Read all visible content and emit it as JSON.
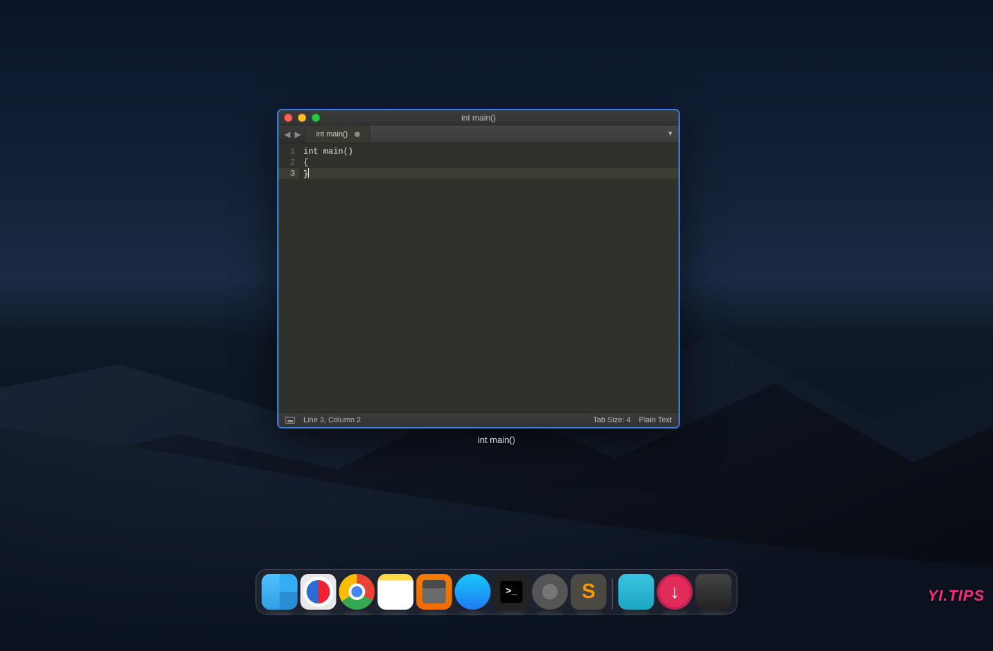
{
  "window": {
    "title": "int main()",
    "tab": {
      "label": "int main()",
      "dirty": true
    },
    "code": {
      "lines": [
        {
          "num": "1",
          "text": "int main()"
        },
        {
          "num": "2",
          "text": "{"
        },
        {
          "num": "3",
          "text": "}",
          "active": true
        }
      ]
    },
    "status": {
      "position": "Line 3, Column 2",
      "tab_size": "Tab Size: 4",
      "syntax": "Plain Text"
    },
    "tabmenu_glyph": "▼",
    "nav_prev": "◀",
    "nav_next": "▶"
  },
  "caption": "int main()",
  "dock": [
    {
      "name": "finder",
      "class": "di-finder"
    },
    {
      "name": "safari",
      "class": "di-safari"
    },
    {
      "name": "chrome",
      "class": "di-chrome"
    },
    {
      "name": "notes",
      "class": "di-notes"
    },
    {
      "name": "calculator",
      "class": "di-calc"
    },
    {
      "name": "app-store",
      "class": "di-appstore"
    },
    {
      "name": "terminal",
      "class": "di-terminal"
    },
    {
      "name": "system-preferences",
      "class": "di-prefs"
    },
    {
      "name": "sublime-text",
      "class": "di-sublime"
    },
    {
      "name": "applications-folder",
      "class": "di-folder"
    },
    {
      "name": "downloads",
      "class": "di-dl"
    },
    {
      "name": "trash",
      "class": "di-trash"
    }
  ],
  "watermark": "YI.TIPS"
}
